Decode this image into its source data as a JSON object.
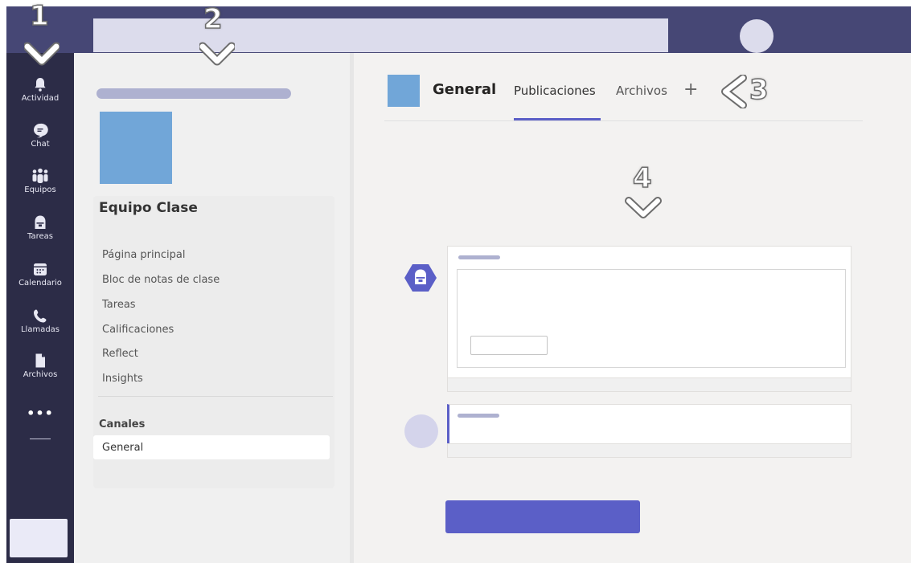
{
  "colors": {
    "rail": "#2c2c47",
    "topbar": "#464775",
    "accent": "#5b5fc7",
    "team_avatar": "#71a6d8",
    "placeholder": "#dcdcec"
  },
  "rail": {
    "items": [
      {
        "label": "Actividad",
        "icon": "bell-icon"
      },
      {
        "label": "Chat",
        "icon": "chat-icon"
      },
      {
        "label": "Equipos",
        "icon": "teams-icon"
      },
      {
        "label": "Tareas",
        "icon": "backpack-icon"
      },
      {
        "label": "Calendario",
        "icon": "calendar-icon"
      },
      {
        "label": "Llamadas",
        "icon": "phone-icon"
      },
      {
        "label": "Archivos",
        "icon": "file-icon"
      }
    ],
    "more": "•••"
  },
  "team": {
    "name": "Equipo Clase",
    "nav": [
      "Página principal",
      "Bloc de notas de clase",
      "Tareas",
      "Calificaciones",
      "Reflect",
      "Insights"
    ],
    "channels_heading": "Canales",
    "channels": [
      "General"
    ]
  },
  "channel": {
    "title": "General",
    "tabs": [
      "Publicaciones",
      "Archivos"
    ],
    "active_tab": "Publicaciones",
    "add_tab": "+"
  },
  "callouts": {
    "n1": "1",
    "n2": "2",
    "n3": "3",
    "n4": "4"
  }
}
